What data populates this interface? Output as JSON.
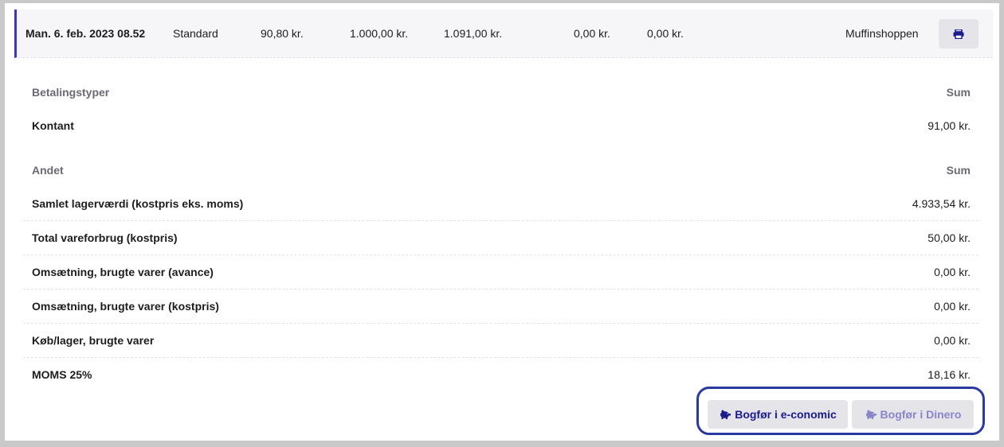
{
  "summary_row": {
    "date": "Man. 6. feb. 2023 08.52",
    "type": "Standard",
    "amount_1": "90,80 kr.",
    "amount_2": "1.000,00 kr.",
    "amount_3": "1.091,00 kr.",
    "amount_4": "0,00 kr.",
    "amount_5": "0,00 kr.",
    "shop": "Muffinshoppen",
    "print_icon": "printer-icon"
  },
  "payment_section": {
    "header_label": "Betalingstyper",
    "header_sum": "Sum",
    "rows": [
      {
        "label": "Kontant",
        "value": "91,00 kr."
      }
    ]
  },
  "other_section": {
    "header_label": "Andet",
    "header_sum": "Sum",
    "rows": [
      {
        "label": "Samlet lagerværdi (kostpris eks. moms)",
        "value": "4.933,54 kr."
      },
      {
        "label": "Total vareforbrug (kostpris)",
        "value": "50,00 kr."
      },
      {
        "label": "Omsætning, brugte varer (avance)",
        "value": "0,00 kr."
      },
      {
        "label": "Omsætning, brugte varer (kostpris)",
        "value": "0,00 kr."
      },
      {
        "label": "Køb/lager, brugte varer",
        "value": "0,00 kr."
      },
      {
        "label": "MOMS 25%",
        "value": "18,16 kr."
      }
    ]
  },
  "actions": {
    "economic_label": "Bogfør i e-conomic",
    "dinero_label": "Bogfør i Dinero",
    "icon": "piggy-bank-icon",
    "colors": {
      "primary": "#1b1b8c",
      "disabled": "#8a86c9",
      "accent_border": "#3b35c4",
      "highlight_ring": "#2a3aa0"
    }
  }
}
